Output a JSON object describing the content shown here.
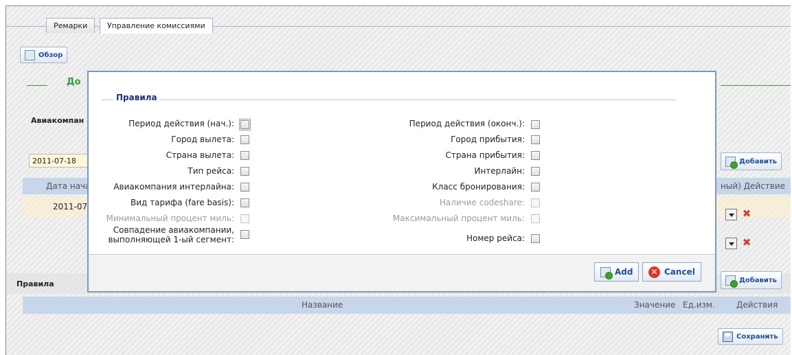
{
  "tabs": [
    {
      "label": "Ремарки",
      "active": false
    },
    {
      "label": "Управление комиссиями",
      "active": true
    }
  ],
  "toolbar": {
    "overview_label": "Обзор"
  },
  "background": {
    "section_title_partial": "До",
    "airline_label_partial": "Авиакомпан",
    "date_value": "2011-07-18",
    "grid1_header_partial": "Дата нача",
    "grid1_row_date_partial": "2011-07-",
    "grid1_header_right_partial": "ный) Действие",
    "add_label": "Добавить",
    "rules_label": "Правила",
    "grid2_headers": [
      "Название",
      "Значение",
      "Ед.изм.",
      "Действия"
    ],
    "save_label": "Сохранить"
  },
  "modal": {
    "legend": "Правила",
    "left_rows": [
      {
        "label": "Период действия (нач.):",
        "disabled": false,
        "focused": true
      },
      {
        "label": "Город вылета:",
        "disabled": false
      },
      {
        "label": "Страна вылета:",
        "disabled": false
      },
      {
        "label": "Тип рейса:",
        "disabled": false
      },
      {
        "label": "Авиакомпания интерлайна:",
        "disabled": false
      },
      {
        "label": "Вид тарифа (fare basis):",
        "disabled": false
      },
      {
        "label": "Минимальный процент миль:",
        "disabled": true
      },
      {
        "label_line1": "Совпадение авиакомпании,",
        "label_line2": "выполняющей 1-ый сегмент:",
        "disabled": false
      }
    ],
    "right_rows": [
      {
        "label": "Период действия (оконч.):",
        "disabled": false
      },
      {
        "label": "Город прибытия:",
        "disabled": false
      },
      {
        "label": "Страна прибытия:",
        "disabled": false
      },
      {
        "label": "Интерлайн:",
        "disabled": false
      },
      {
        "label": "Класс бронирования:",
        "disabled": false
      },
      {
        "label": "Наличие codeshare:",
        "disabled": true
      },
      {
        "label": "Максимальный процент миль:",
        "disabled": true
      },
      {
        "label": "Номер рейса:",
        "disabled": false
      }
    ],
    "add_button": "Add",
    "cancel_button": "Cancel"
  },
  "colors": {
    "accent_blue": "#1f4e96",
    "section_green": "#3a9a3a",
    "modal_border": "#7b98c4",
    "grid_header": "#c7d6ea"
  }
}
